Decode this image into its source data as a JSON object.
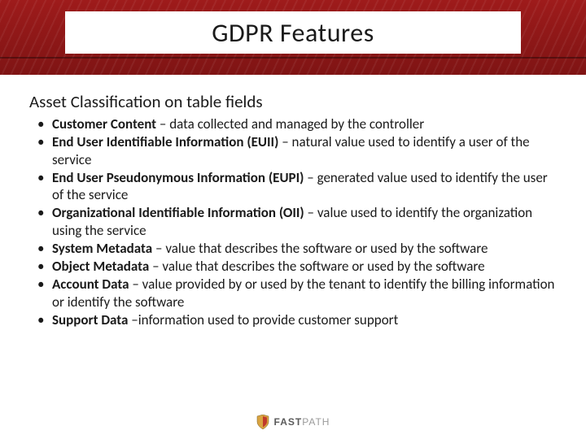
{
  "title": "GDPR Features",
  "subheading": "Asset Classification on table fields",
  "items": [
    {
      "term": "Customer Content",
      "sep": " – ",
      "desc": "data collected and managed by the controller"
    },
    {
      "term": "End User Identifiable Information (EUII)",
      "sep": " – ",
      "desc": "natural value used to identify a user of the service"
    },
    {
      "term": "End User Pseudonymous Information (EUPI)",
      "sep": " – ",
      "desc": "generated value used to identify the user of the service"
    },
    {
      "term": "Organizational Identifiable Information (OII)",
      "sep": " – ",
      "desc": "value used to identify the organization using the service"
    },
    {
      "term": "System Metadata",
      "sep": " – ",
      "desc": "value that describes the software or used by the software"
    },
    {
      "term": "Object Metadata",
      "sep": " – ",
      "desc": "value that describes the software or used by the software"
    },
    {
      "term": "Account Data",
      "sep": " – ",
      "desc": "value provided by or used by the tenant to identify the billing information or identify the software"
    },
    {
      "term": "Support Data",
      "sep": " –",
      "desc": "information used to provide customer support"
    }
  ],
  "logo": {
    "fast": "FAST",
    "path": "PATH"
  }
}
